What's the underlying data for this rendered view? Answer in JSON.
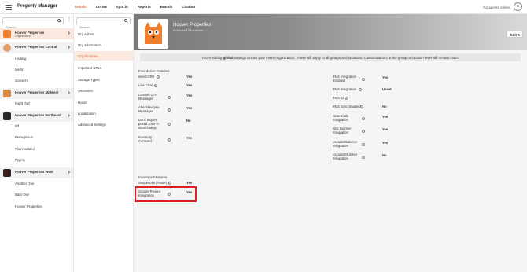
{
  "app": {
    "title": "Property Manager",
    "agents_status": "No agents online"
  },
  "nav": [
    {
      "label": "Details",
      "active": true
    },
    {
      "label": "Cortex"
    },
    {
      "label": "spot.io"
    },
    {
      "label": "Reports"
    },
    {
      "label": "Brands"
    },
    {
      "label": "Chatbot"
    }
  ],
  "left": {
    "search_placeholder": "Search...",
    "groups": [
      {
        "name": "Hoover Properties",
        "sub": "Organization",
        "locations": []
      },
      {
        "name": "Hoover Properties Central",
        "locations": [
          "Hedwig",
          "Merlin",
          "Screech"
        ]
      },
      {
        "name": "Hoover Properties Midwest",
        "locations": [
          "Night Owl"
        ]
      },
      {
        "name": "Hoover Properties Northeast",
        "locations": [
          "Elf",
          "Ferruginous",
          "Flammulated",
          "Pygmy"
        ]
      },
      {
        "name": "Hoover Properties West",
        "locations": [
          "Another One",
          "Barn Owl",
          "Hoover Properties"
        ]
      }
    ]
  },
  "mid": {
    "search_placeholder": "Search...",
    "items": [
      "Org Admin",
      "Org Information",
      "Org Features",
      "Important URLs",
      "Storage Types",
      "Amenities",
      "Hours",
      "Localization",
      "Advanced Settings"
    ]
  },
  "header": {
    "title": "Hoover Properties",
    "subtitle": "4 Groups 12 Locations",
    "edit_label": "Edit"
  },
  "notice": {
    "before": "You're editing ",
    "bold": "global",
    "after": " settings across your entire organization. These will apply to all groups and locations. Customizations at the group or location level will remain intact."
  },
  "foundation": {
    "title": "Foundation Features",
    "rows": [
      {
        "label": "swivl CRM",
        "value": "Yes"
      },
      {
        "label": "Live Chat",
        "value": "Yes"
      },
      {
        "label": "Custom CTA Messages",
        "value": "Yes"
      },
      {
        "label": "After Navigate Messages",
        "value": "Yes"
      },
      {
        "label": "Don't require postal code in store lookup",
        "value": "No"
      },
      {
        "label": "Inventory Carousel",
        "value": "Yes"
      }
    ]
  },
  "fms": {
    "rows": [
      {
        "label": "FMS Integration Enabled",
        "value": "Yes"
      },
      {
        "label": "FMS Integration",
        "value": "Unset"
      },
      {
        "label": "FMS ID",
        "value": ""
      },
      {
        "label": "FMS Sync Enabled",
        "value": "No"
      },
      {
        "label": "Gate Code Integration",
        "value": "Yes"
      },
      {
        "label": "Unit Number Integration",
        "value": "Yes"
      },
      {
        "label": "Account Balance Integration",
        "value": "Yes"
      },
      {
        "label": "Account Number Integration",
        "value": "No"
      }
    ]
  },
  "innovator": {
    "title": "Innovator Features",
    "rows": [
      {
        "label": "Sequences (FMS+)",
        "value": "Yes"
      },
      {
        "label": "Google Review Integration",
        "value": "Yes"
      }
    ]
  },
  "colors": {
    "accent": "#e0743a",
    "highlight": "#e0201e",
    "avatar_orange": "#f07d2a"
  }
}
